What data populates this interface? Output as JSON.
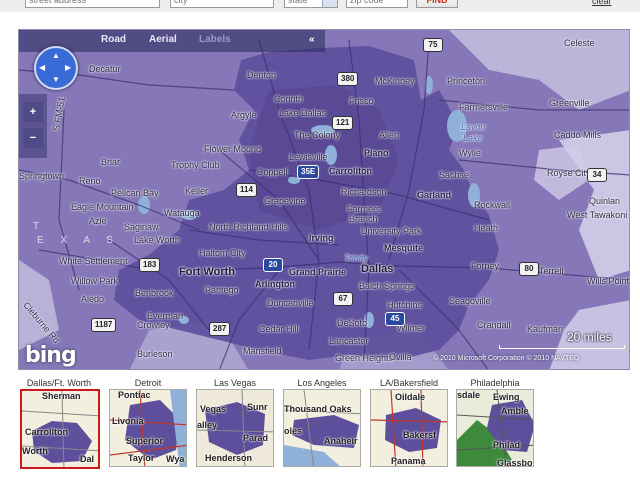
{
  "search": {
    "address_placeholder": "street address",
    "city_placeholder": "city",
    "state_placeholder": "state",
    "zip_placeholder": "zip code",
    "find_label": "FIND",
    "clear_label": "clear"
  },
  "map": {
    "nav": {
      "road_label": "Road",
      "aerial_label": "Aerial",
      "labels_label": "Labels",
      "collapse_label": "«"
    },
    "zoom_in_label": "+",
    "zoom_out_label": "−",
    "logo": "bing",
    "scale_label": "20 miles",
    "copyright": "© 2010 Microsoft Corporation   © 2010 NAVTEQ",
    "colors": {
      "water": "#8fb0d8",
      "coverage": "#5e4f9c",
      "base": "#8678b8"
    },
    "labels": [
      {
        "text": "Decatur",
        "cls": ""
      },
      {
        "text": "Denton",
        "cls": ""
      },
      {
        "text": "McKinney",
        "cls": ""
      },
      {
        "text": "Celeste",
        "cls": ""
      },
      {
        "text": "Princeton",
        "cls": ""
      },
      {
        "text": "Farmersville",
        "cls": ""
      },
      {
        "text": "Greenville",
        "cls": ""
      },
      {
        "text": "Corinth",
        "cls": ""
      },
      {
        "text": "Frisco",
        "cls": ""
      },
      {
        "text": "Lake Dallas",
        "cls": ""
      },
      {
        "text": "Argyle",
        "cls": ""
      },
      {
        "text": "The Colony",
        "cls": ""
      },
      {
        "text": "Allen",
        "cls": ""
      },
      {
        "text": "Lavon",
        "cls": "water"
      },
      {
        "text": "Lake",
        "cls": "water"
      },
      {
        "text": "Caddo Mills",
        "cls": ""
      },
      {
        "text": "Flower Mound",
        "cls": ""
      },
      {
        "text": "Lewisville",
        "cls": ""
      },
      {
        "text": "Plano",
        "cls": "mid"
      },
      {
        "text": "Wylie",
        "cls": ""
      },
      {
        "text": "Briar",
        "cls": ""
      },
      {
        "text": "Trophy Club",
        "cls": ""
      },
      {
        "text": "Coppell",
        "cls": ""
      },
      {
        "text": "Carrollton",
        "cls": "mid"
      },
      {
        "text": "Royse City",
        "cls": ""
      },
      {
        "text": "Reno",
        "cls": ""
      },
      {
        "text": "Pelican Bay",
        "cls": ""
      },
      {
        "text": "Keller",
        "cls": ""
      },
      {
        "text": "Richardson",
        "cls": ""
      },
      {
        "text": "Garland",
        "cls": "mid"
      },
      {
        "text": "Quinlan",
        "cls": ""
      },
      {
        "text": "Eagle Mountain",
        "cls": ""
      },
      {
        "text": "Grapevine",
        "cls": ""
      },
      {
        "text": "Farmers",
        "cls": ""
      },
      {
        "text": "Branch",
        "cls": ""
      },
      {
        "text": "Rockwall",
        "cls": ""
      },
      {
        "text": "West Tawakoni",
        "cls": ""
      },
      {
        "text": "Azle",
        "cls": ""
      },
      {
        "text": "Saginaw",
        "cls": ""
      },
      {
        "text": "Watauga",
        "cls": ""
      },
      {
        "text": "North Richland Hills",
        "cls": ""
      },
      {
        "text": "Irving",
        "cls": "mid"
      },
      {
        "text": "University Park",
        "cls": ""
      },
      {
        "text": "Heath",
        "cls": ""
      },
      {
        "text": "Lake Worth",
        "cls": ""
      },
      {
        "text": "Haltom City",
        "cls": ""
      },
      {
        "text": "Mesquite",
        "cls": "mid"
      },
      {
        "text": "Wills Point",
        "cls": ""
      },
      {
        "text": "White Settlement",
        "cls": ""
      },
      {
        "text": "Forney",
        "cls": ""
      },
      {
        "text": "Willow Park",
        "cls": ""
      },
      {
        "text": "Fort Worth",
        "cls": "big"
      },
      {
        "text": "Grand Prairie",
        "cls": "mid"
      },
      {
        "text": "Dallas",
        "cls": "big"
      },
      {
        "text": "Terrell",
        "cls": ""
      },
      {
        "text": "Aledo",
        "cls": ""
      },
      {
        "text": "Arlington",
        "cls": "mid"
      },
      {
        "text": "Balch Springs",
        "cls": ""
      },
      {
        "text": "Benbrook",
        "cls": ""
      },
      {
        "text": "Pantego",
        "cls": ""
      },
      {
        "text": "Duncanville",
        "cls": ""
      },
      {
        "text": "Hutchins",
        "cls": ""
      },
      {
        "text": "Seagoville",
        "cls": ""
      },
      {
        "text": "Crowley",
        "cls": ""
      },
      {
        "text": "Everman",
        "cls": ""
      },
      {
        "text": "Cedar Hill",
        "cls": ""
      },
      {
        "text": "DeSoto",
        "cls": ""
      },
      {
        "text": "Wilmer",
        "cls": ""
      },
      {
        "text": "Crandall",
        "cls": ""
      },
      {
        "text": "Kaufman",
        "cls": ""
      },
      {
        "text": "Burleson",
        "cls": ""
      },
      {
        "text": "Mansfield",
        "cls": ""
      },
      {
        "text": "Lancaster",
        "cls": ""
      },
      {
        "text": "Green Heights",
        "cls": ""
      },
      {
        "text": "Springtown",
        "cls": ""
      },
      {
        "text": "Ovilla",
        "cls": ""
      },
      {
        "text": "Sachse",
        "cls": ""
      },
      {
        "text": "Trinity",
        "cls": "water"
      },
      {
        "text": "S FM-51",
        "cls": ""
      },
      {
        "text": "Cleburne Rd",
        "cls": ""
      },
      {
        "text": "T",
        "cls": "region"
      },
      {
        "text": "E X A S",
        "cls": "region"
      }
    ],
    "shields": [
      {
        "text": "75",
        "cls": "us"
      },
      {
        "text": "380",
        "cls": "us"
      },
      {
        "text": "121",
        "cls": "us"
      },
      {
        "text": "114",
        "cls": "us"
      },
      {
        "text": "35E",
        "cls": "i"
      },
      {
        "text": "183",
        "cls": "us"
      },
      {
        "text": "20",
        "cls": "i"
      },
      {
        "text": "67",
        "cls": "us"
      },
      {
        "text": "1187",
        "cls": "us"
      },
      {
        "text": "34",
        "cls": "us"
      },
      {
        "text": "80",
        "cls": "us"
      },
      {
        "text": "287",
        "cls": "us"
      },
      {
        "text": "45",
        "cls": "i"
      }
    ]
  },
  "thumbnails": [
    {
      "title": "Dallas/Ft. Worth",
      "selected": true,
      "labels": [
        "Sherman",
        "Carrollton",
        "Worth",
        "Dal"
      ]
    },
    {
      "title": "Detroit",
      "selected": false,
      "labels": [
        "Pontiac",
        "Livonia",
        "Superior",
        "Taylor",
        "Wya"
      ]
    },
    {
      "title": "Las Vegas",
      "selected": false,
      "labels": [
        "Vegas",
        "Sunr",
        "alley",
        "Parad",
        "Henderson"
      ]
    },
    {
      "title": "Los Angeles",
      "selected": false,
      "labels": [
        "Thousand Oaks",
        "oles",
        "Anaheir"
      ]
    },
    {
      "title": "LA/Bakersfield",
      "selected": false,
      "labels": [
        "Oildale",
        "Bakersf",
        "Panama"
      ]
    },
    {
      "title": "Philadelphia",
      "selected": false,
      "labels": [
        "Ewing",
        "Amble",
        "Philad",
        "Glassbo",
        "sdale"
      ]
    }
  ]
}
